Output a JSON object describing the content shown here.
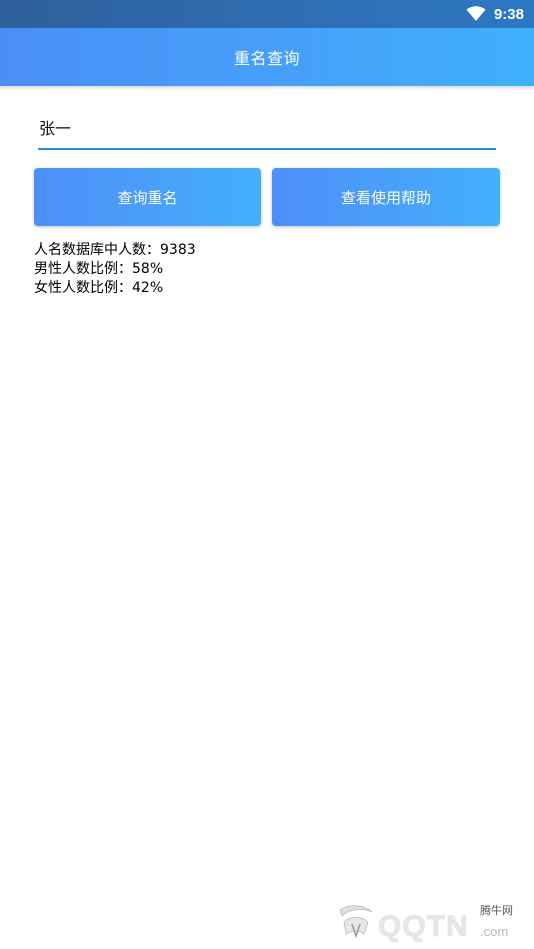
{
  "status_bar": {
    "time": "9:38",
    "icons": [
      "wifi-icon"
    ]
  },
  "app_bar": {
    "title": "重名查询"
  },
  "search": {
    "value": "张一",
    "placeholder": ""
  },
  "buttons": {
    "query_label": "查询重名",
    "help_label": "查看使用帮助"
  },
  "stats": {
    "total_line": "人名数据库中人数：9383",
    "male_line": "男性人数比例：58%",
    "female_line": "女性人数比例：42%"
  },
  "watermark": {
    "site": "腾牛网",
    "logo_text": "QQTN",
    "suffix": ".com"
  },
  "colors": {
    "accent": "#2c8be0",
    "app_bar": "#46a0fa",
    "status_bar": "#2f6db0"
  }
}
